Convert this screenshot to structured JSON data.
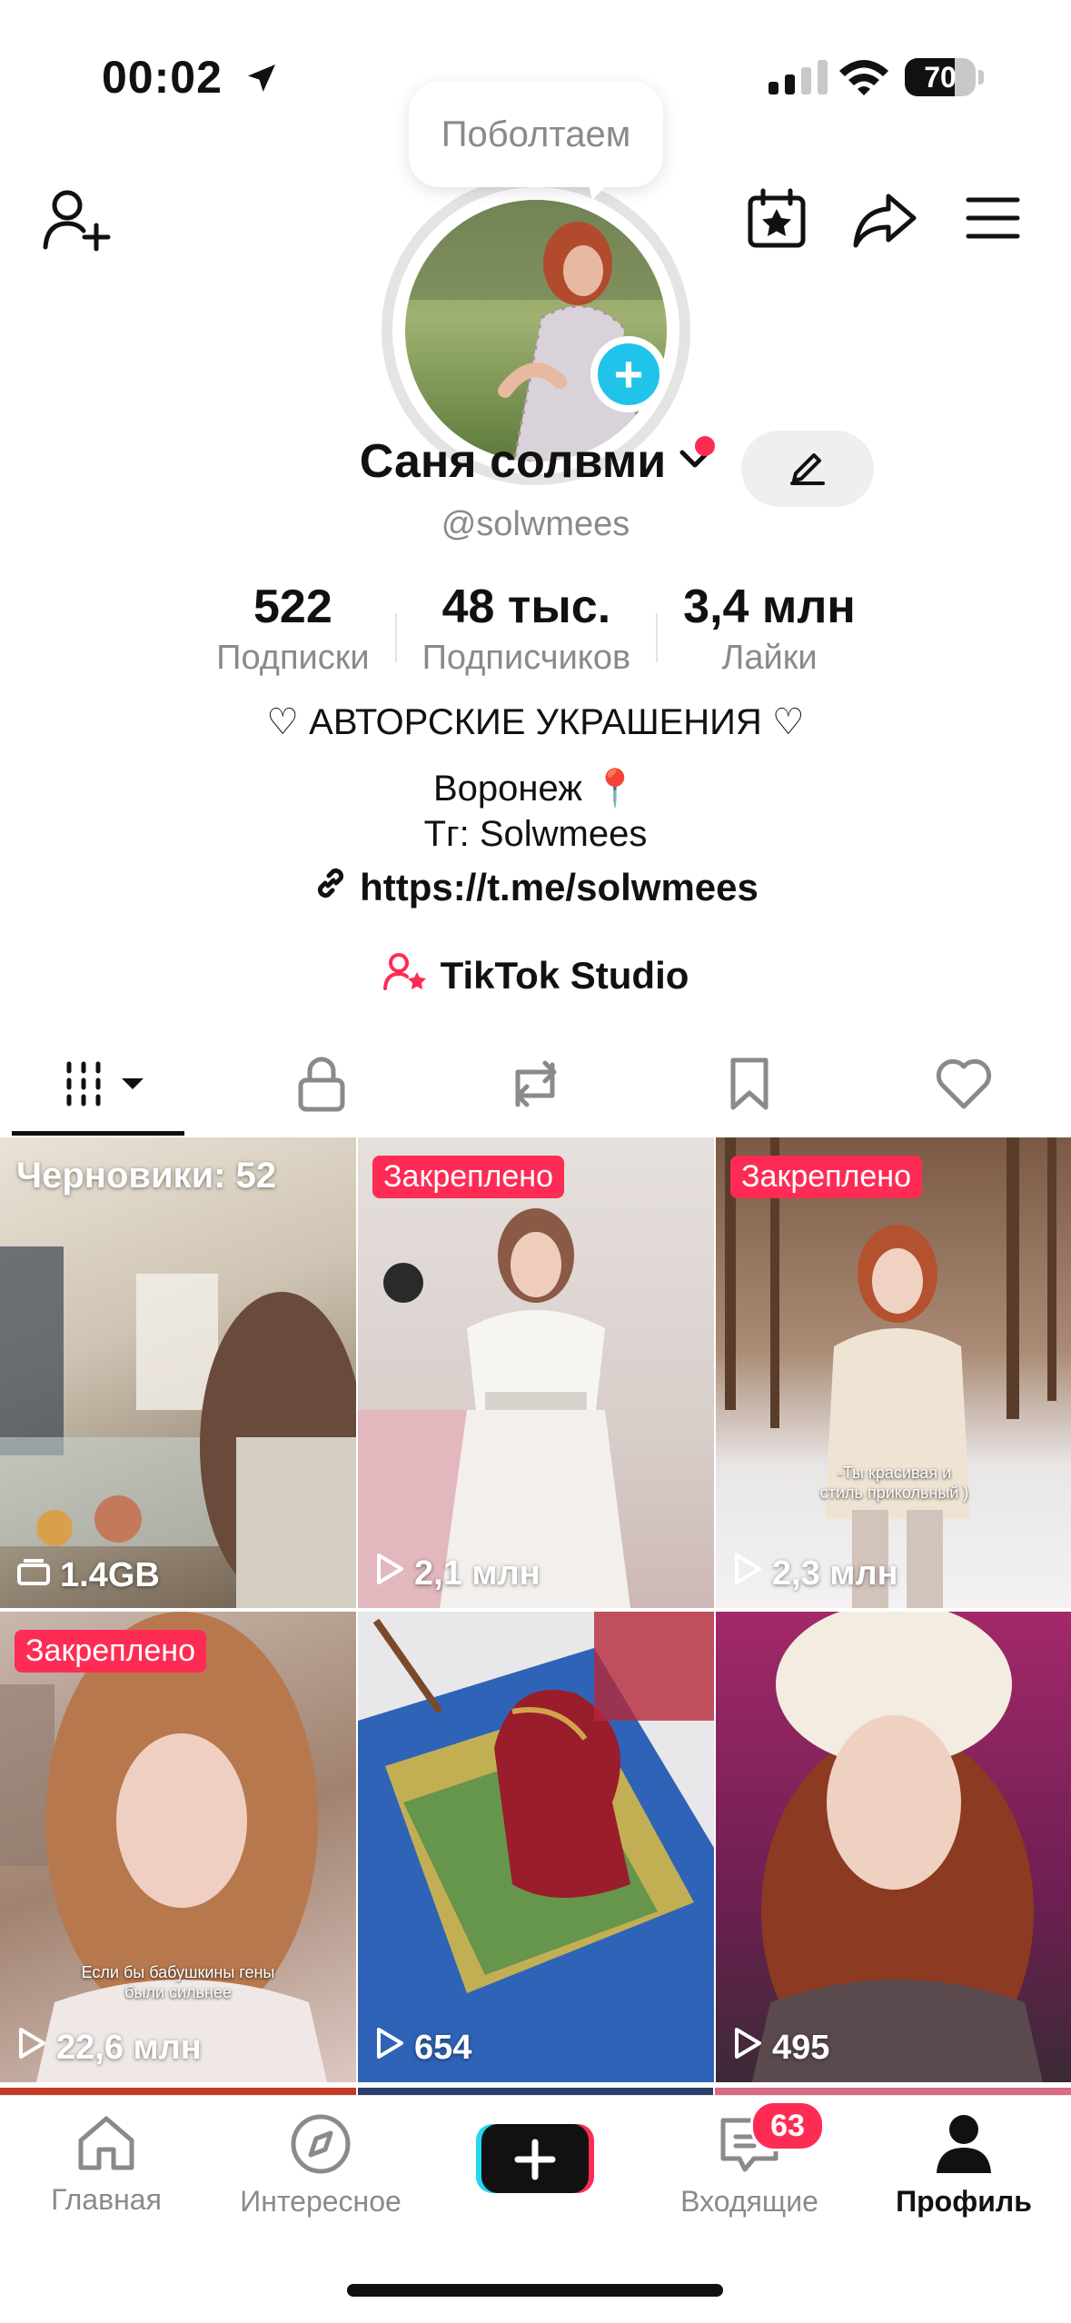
{
  "status_bar": {
    "time": "00:02",
    "battery": "70",
    "battery_level": 0.7
  },
  "header": {
    "bubble_text": "Поболтаем"
  },
  "profile": {
    "name": "Саня солвми",
    "handle": "@solwmees",
    "stats": [
      {
        "value": "522",
        "label": "Подписки"
      },
      {
        "value": "48 тыс.",
        "label": "Подписчиков"
      },
      {
        "value": "3,4 млн",
        "label": "Лайки"
      }
    ],
    "bio": [
      "♡ АВТОРСКИЕ УКРАШЕНИЯ ♡",
      "Воронеж 📍",
      "Тг: Solwmees"
    ],
    "link": "https://t.me/solwmees",
    "studio_label": "TikTok Studio"
  },
  "tabs": [
    "videos",
    "private",
    "reposts",
    "favorites",
    "liked"
  ],
  "grid": [
    {
      "label": "Черновики: 52",
      "views": "1.4GB",
      "views_icon": "drafts-icon"
    },
    {
      "pinned": "Закреплено",
      "views": "2,1 млн"
    },
    {
      "pinned": "Закреплено",
      "views": "2,3 млн",
      "caption": "-Ты красивая и стиль прикольный )"
    },
    {
      "pinned": "Закреплено",
      "views": "22,6 млн",
      "caption": "Если бы бабушкины гены были сильнее"
    },
    {
      "views": "654"
    },
    {
      "views": "495"
    }
  ],
  "nav": {
    "home": "Главная",
    "discover": "Интересное",
    "inbox": "Входящие",
    "inbox_badge": "63",
    "profile": "Профиль"
  },
  "colors": {
    "accent": "#fe2c55",
    "cyan": "#20c3e9"
  }
}
